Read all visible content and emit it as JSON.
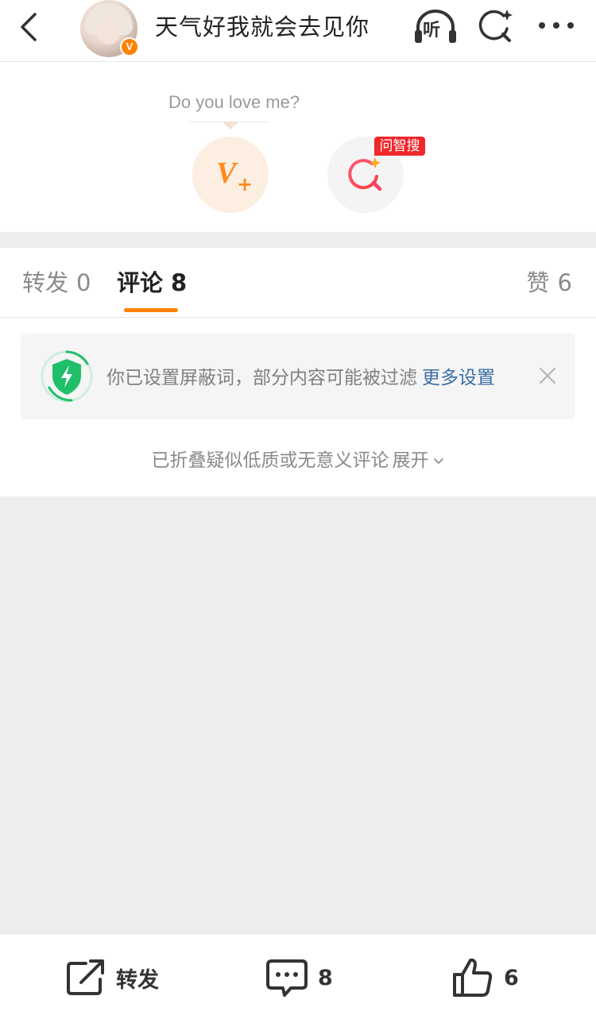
{
  "header": {
    "back_icon": "chevron-left-icon",
    "avatar_badge": "V",
    "title": "天气好我就会去见你",
    "listen_label": "听",
    "search_icon": "smart-search-icon",
    "more_icon": "more-dots-icon"
  },
  "top": {
    "prompt": "Do you love me?",
    "vplus_label": "V",
    "vplus_plus": "+",
    "smart_search_tag": "问智搜"
  },
  "tabs": [
    {
      "label": "转发",
      "count": "0"
    },
    {
      "label": "评论",
      "count": "8"
    },
    {
      "label": "赞",
      "count": "6"
    }
  ],
  "notice": {
    "text": "你已设置屏蔽词，部分内容可能被过滤",
    "link": "更多设置"
  },
  "folded": {
    "text": "已折叠疑似低质或无意义评论",
    "expand": "展开"
  },
  "bottombar": {
    "repost_label": "转发",
    "comment_count": "8",
    "like_count": "6"
  },
  "colors": {
    "accent": "#ff8200",
    "link": "#3b6ea8",
    "shield": "#1fbf6a",
    "tag": "#f0282b"
  }
}
